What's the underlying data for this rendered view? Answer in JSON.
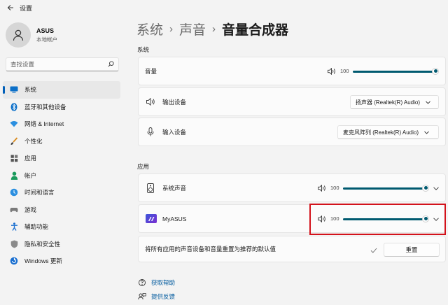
{
  "window": {
    "title": "设置"
  },
  "profile": {
    "name": "ASUS",
    "account_type": "本地帐户"
  },
  "search": {
    "placeholder": "查找设置"
  },
  "nav": {
    "items": [
      {
        "label": "系统",
        "icon": "monitor-icon"
      },
      {
        "label": "蓝牙和其他设备",
        "icon": "bluetooth-icon"
      },
      {
        "label": "网络 & Internet",
        "icon": "wifi-icon"
      },
      {
        "label": "个性化",
        "icon": "brush-icon"
      },
      {
        "label": "应用",
        "icon": "apps-icon"
      },
      {
        "label": "帐户",
        "icon": "person-icon"
      },
      {
        "label": "时间和语言",
        "icon": "globe-clock-icon"
      },
      {
        "label": "游戏",
        "icon": "gamepad-icon"
      },
      {
        "label": "辅助功能",
        "icon": "accessibility-icon"
      },
      {
        "label": "隐私和安全性",
        "icon": "shield-icon"
      },
      {
        "label": "Windows 更新",
        "icon": "update-icon"
      }
    ],
    "active_index": 0
  },
  "breadcrumb": {
    "crumb1": "系统",
    "crumb2": "声音",
    "current": "音量合成器",
    "separator": "›"
  },
  "system_section": {
    "label": "系统",
    "volume": {
      "label": "音量",
      "value": "100",
      "level": 1.0
    },
    "output": {
      "label": "输出设备",
      "device": "扬声器 (Realtek(R) Audio)"
    },
    "input": {
      "label": "输入设备",
      "device": "麦克风阵列 (Realtek(R) Audio)"
    }
  },
  "apps_section": {
    "label": "应用",
    "system_sounds": {
      "label": "系统声音",
      "value": "100",
      "level": 1.0
    },
    "myasus": {
      "label": "MyASUS",
      "value": "100",
      "level": 1.0
    },
    "reset": {
      "label": "将所有应用的声音设备和音量重置为推荐的默认值",
      "button": "重置"
    }
  },
  "help": {
    "get_help": "获取帮助",
    "feedback": "提供反馈"
  },
  "colors": {
    "accent": "#005a70",
    "highlight_box": "#d3121b",
    "link": "#005a9e"
  }
}
